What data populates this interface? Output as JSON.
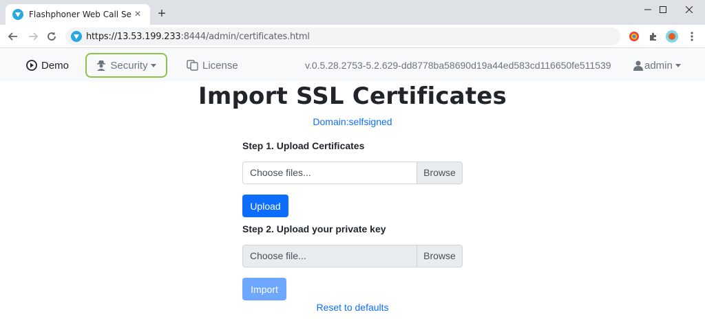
{
  "browser": {
    "tab_title": "Flashphoner Web Call Server",
    "url_host": "https://13.53.199.233",
    "url_rest": ":8444/admin/certificates.html"
  },
  "navbar": {
    "demo": "Demo",
    "security": "Security",
    "license": "License",
    "version": "v.0.5.28.2753-5.2.629-dd8778ba58690d19a44ed583cd116650fe511539",
    "admin": "admin"
  },
  "page": {
    "title": "Import SSL Certificates",
    "domain_link": "Domain:selfsigned",
    "step1_label": "Step 1. Upload Certificates",
    "step1_placeholder": "Choose files...",
    "browse_label": "Browse",
    "upload_button": "Upload",
    "step2_label": "Step 2. Upload your private key",
    "step2_placeholder": "Choose file...",
    "import_button": "Import",
    "reset_link": "Reset to defaults"
  },
  "colors": {
    "primary": "#0d6efd",
    "primary_disabled": "#6ea8fe",
    "security_highlight": "#8bc34a"
  }
}
